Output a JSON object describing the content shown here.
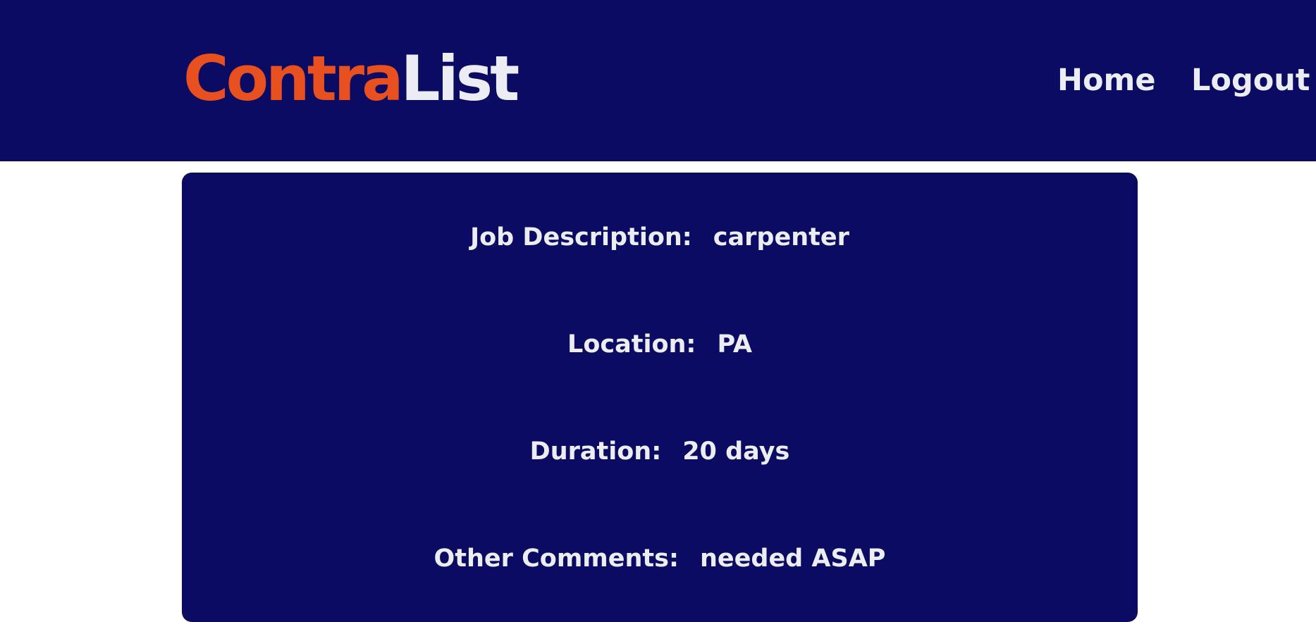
{
  "header": {
    "logo_part1": "Contra",
    "logo_part2": "List",
    "nav": {
      "home": "Home",
      "logout": "Logout"
    }
  },
  "job": {
    "description_label": "Job Description:",
    "description_value": "carpenter",
    "location_label": "Location:",
    "location_value": "PA",
    "duration_label": "Duration:",
    "duration_value": "20 days",
    "comments_label": "Other Comments:",
    "comments_value": "needed ASAP"
  },
  "colors": {
    "primary": "#0b0b63",
    "accent": "#e8511f",
    "text": "#ececf4"
  }
}
